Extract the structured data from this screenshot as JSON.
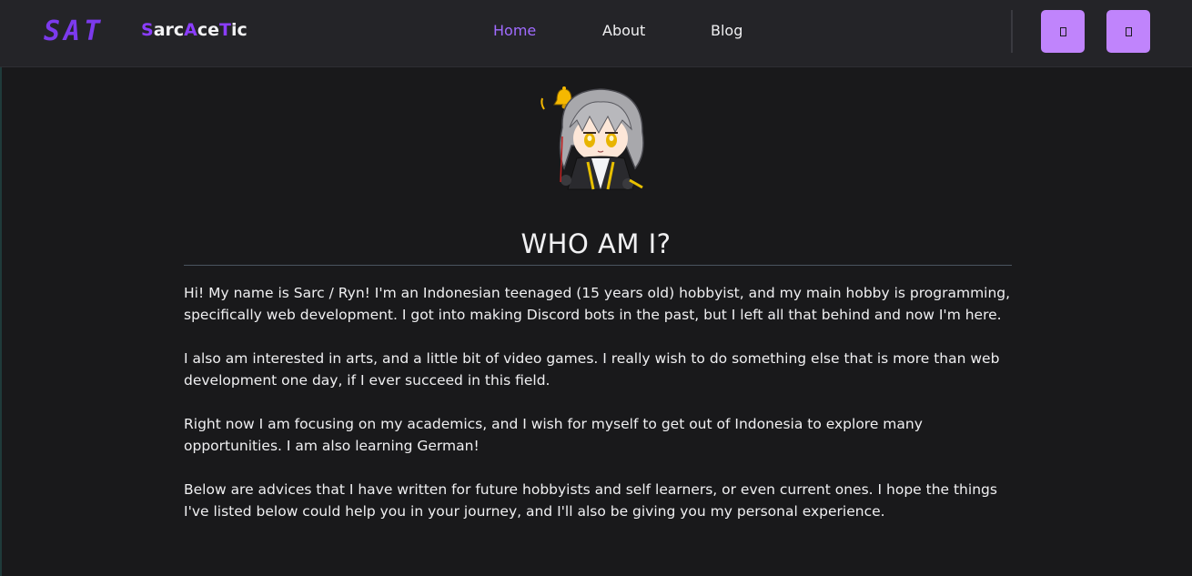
{
  "header": {
    "logo_text": "SAT",
    "brand": {
      "part1": "S",
      "part2": "arc",
      "part3": "A",
      "part4": "ce",
      "part5": "T",
      "part6": "ic"
    },
    "nav": [
      {
        "label": "Home",
        "active": true
      },
      {
        "label": "About",
        "active": false
      },
      {
        "label": "Blog",
        "active": false
      }
    ],
    "icon_buttons": [
      {
        "icon": "theme-toggle-icon"
      },
      {
        "icon": "menu-icon"
      }
    ]
  },
  "main": {
    "avatar": "chibi-character-avatar",
    "title": "WHO AM I?",
    "paragraphs": [
      "Hi! My name is Sarc / Ryn! I'm an Indonesian teenaged (15 years old) hobbyist, and my main hobby is programming, specifically web development. I got into making Discord bots in the past, but I left all that behind and now I'm here.",
      "I also am interested in arts, and a little bit of video games. I really wish to do something else that is more than web development one day, if I ever succeed in this field.",
      "Right now I am focusing on my academics, and I wish for myself to get out of Indonesia to explore many opportunities. I am also learning German!",
      "Below are advices that I have written for future hobbyists and self learners, or even current ones. I hope the things I've listed below could help you in your journey, and I'll also be giving you my personal experience."
    ]
  },
  "colors": {
    "accent": "#8b3dff",
    "button": "#c084fc",
    "background": "#19191b",
    "navbar": "#242428"
  }
}
